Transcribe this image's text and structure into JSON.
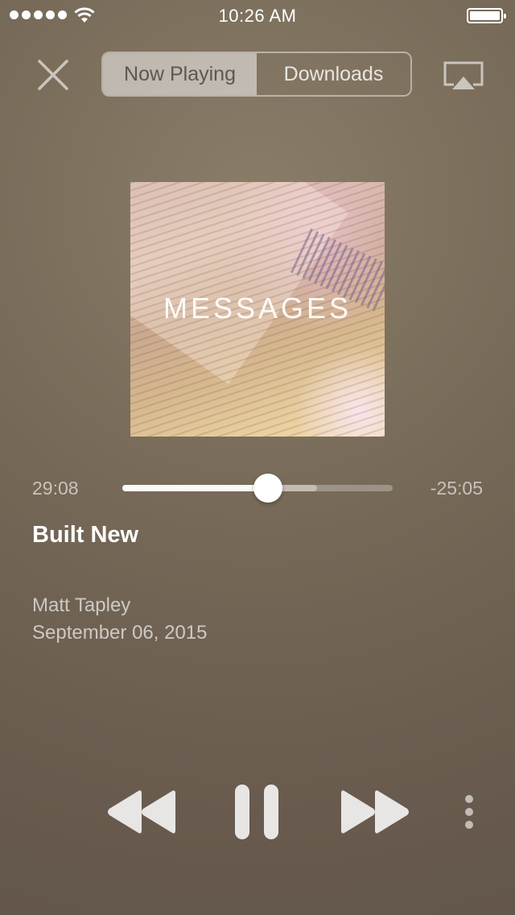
{
  "status_bar": {
    "time": "10:26 AM"
  },
  "nav": {
    "tabs": [
      {
        "label": "Now Playing",
        "active": true
      },
      {
        "label": "Downloads",
        "active": false
      }
    ]
  },
  "artwork": {
    "title": "MESSAGES"
  },
  "progress": {
    "elapsed": "29:08",
    "remaining": "-25:05",
    "played_fraction": 0.54,
    "buffered_fraction": 0.72
  },
  "track": {
    "title": "Built New",
    "speaker": "Matt Tapley",
    "date": "September 06, 2015"
  },
  "icons": {
    "close": "close-icon",
    "airplay": "airplay-icon",
    "rewind": "rewind-icon",
    "pause": "pause-icon",
    "fast_forward": "fast-forward-icon",
    "more": "more-icon"
  },
  "colors": {
    "active_tab_bg": "#c8c2b9",
    "active_tab_text": "#5f574d",
    "background": "#6f6253"
  }
}
